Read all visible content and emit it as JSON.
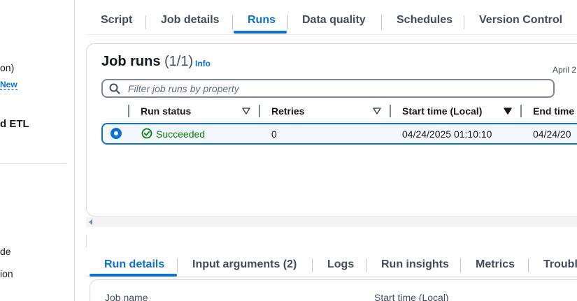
{
  "sidebar": {
    "line1": "on)",
    "new_link": "New",
    "bold_item": "d ETL",
    "line2": "de",
    "line3": "ion"
  },
  "top_tabs": {
    "items": [
      "Script",
      "Job details",
      "Runs",
      "Data quality",
      "Schedules",
      "Version Control"
    ],
    "active": "Runs"
  },
  "job_runs": {
    "title": "Job runs",
    "count": "(1/1)",
    "info": "Info",
    "date_hint": "April 2",
    "filter_placeholder": "Filter job runs by property",
    "columns": [
      "Run status",
      "Retries",
      "Start time (Local)",
      "End time ("
    ],
    "rows": [
      {
        "status": "Succeeded",
        "retries": "0",
        "start_time": "04/24/2025 01:10:10",
        "end_time": "04/24/20"
      }
    ]
  },
  "bottom_tabs": {
    "items": [
      "Run details",
      "Input arguments (2)",
      "Logs",
      "Run insights",
      "Metrics",
      "Troubl"
    ],
    "active": "Run details"
  },
  "run_details": {
    "job_name_label": "Job name",
    "start_time_label": "Start time (Local)"
  },
  "colors": {
    "accent": "#0972d3",
    "success": "#037f0c",
    "border": "#d5dbdb"
  }
}
